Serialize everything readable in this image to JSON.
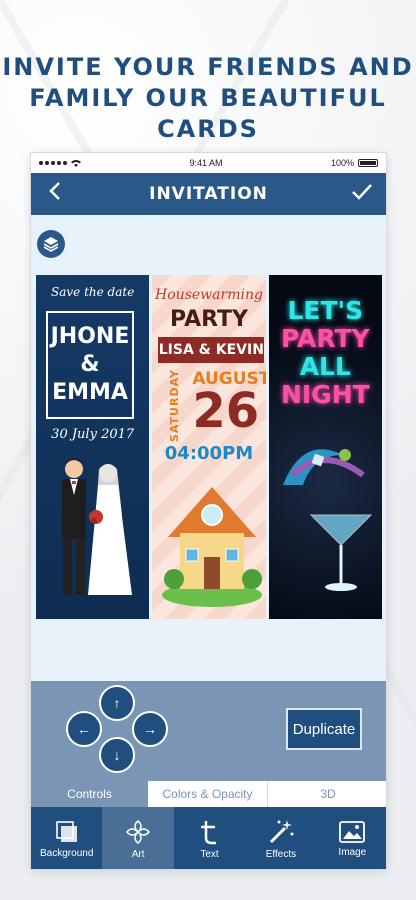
{
  "headline": {
    "line1": "INVITE YOUR FRIENDS AND",
    "line2": "FAMILY OUR BEAUTIFUL CARDS"
  },
  "statusbar": {
    "time": "9:41 AM",
    "battery": "100%"
  },
  "navbar": {
    "title": "INVITATION",
    "back_icon": "chevron-left-icon",
    "done_icon": "checkmark-icon"
  },
  "cards": {
    "card1": {
      "save_the_date": "Save the date",
      "name1": "JHONE",
      "amp": "&",
      "name2": "EMMA",
      "date": "30 July 2017"
    },
    "card2": {
      "top": "Housewarming",
      "party": "PARTY",
      "names": "LISA & KEVIN",
      "weekday": "SATURDAY",
      "month": "AUGUST",
      "day": "26",
      "time": "04:00PM"
    },
    "card3": {
      "line1": "LET'S",
      "line2": "PARTY",
      "line3": "ALL",
      "line4": "NIGHT"
    }
  },
  "controls": {
    "up": "↑",
    "left": "←",
    "right": "→",
    "down": "↓",
    "duplicate": "Duplicate"
  },
  "tabs": {
    "controls": "Controls",
    "colors": "Colors & Opacity",
    "threed": "3D"
  },
  "toolbar": {
    "background": "Background",
    "art": "Art",
    "text": "Text",
    "effects": "Effects",
    "image": "Image"
  },
  "colors": {
    "primary": "#2a5889",
    "panel": "#7a96b4",
    "canvas": "#e8f2fb"
  }
}
